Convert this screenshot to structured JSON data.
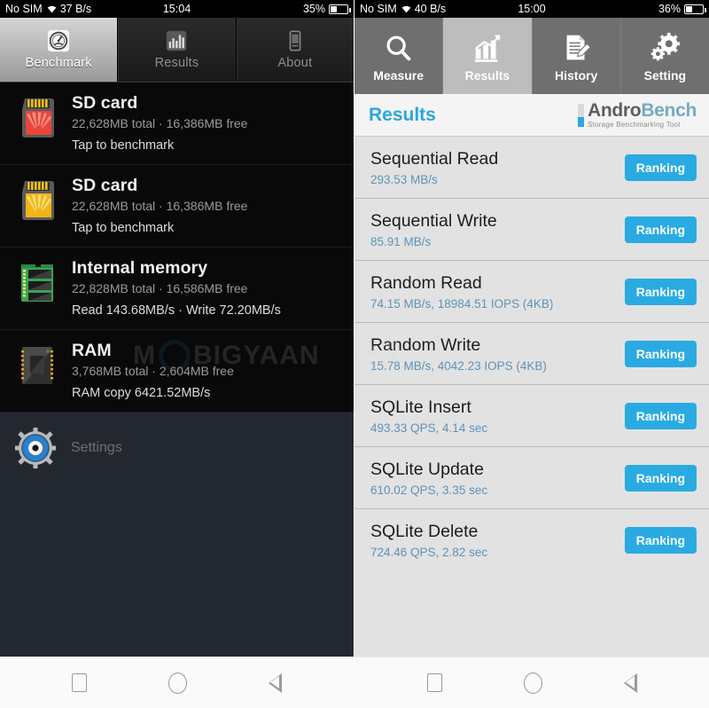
{
  "left_phone": {
    "status_bar": {
      "carrier": "No SIM",
      "wifi_icon": "wifi-icon",
      "network_speed": "37 B/s",
      "clock": "15:04",
      "battery_percent": "35%",
      "battery_icon": "battery-icon"
    },
    "tabs": [
      {
        "label": "Benchmark",
        "icon": "speedometer-icon",
        "active": true
      },
      {
        "label": "Results",
        "icon": "bar-chart-icon",
        "active": false
      },
      {
        "label": "About",
        "icon": "phone-icon",
        "active": false
      }
    ],
    "items": [
      {
        "icon": "sd-card-red-icon",
        "title": "SD card",
        "capacity": "22,628MB total · 16,386MB free",
        "action": "Tap to benchmark"
      },
      {
        "icon": "sd-card-yellow-icon",
        "title": "SD card",
        "capacity": "22,628MB total · 16,386MB free",
        "action": "Tap to benchmark"
      },
      {
        "icon": "memory-module-icon",
        "title": "Internal memory",
        "capacity": "22,828MB total · 16,586MB free",
        "action": "Read 143.68MB/s · Write 72.20MB/s"
      },
      {
        "icon": "ram-chip-icon",
        "title": "RAM",
        "capacity": "3,768MB total · 2,604MB free",
        "action": "RAM copy 6421.52MB/s"
      }
    ],
    "settings": {
      "icon": "gear-eye-icon",
      "label": "Settings"
    },
    "watermark": "MOBIGYAAN",
    "nav_bar": {
      "recents": "recents-square-icon",
      "home": "home-circle-icon",
      "back": "back-triangle-icon"
    }
  },
  "right_phone": {
    "status_bar": {
      "carrier": "No SIM",
      "wifi_icon": "wifi-icon",
      "network_speed": "40 B/s",
      "clock": "15:00",
      "battery_percent": "36%",
      "battery_icon": "battery-icon"
    },
    "tabs": [
      {
        "label": "Measure",
        "icon": "magnifier-icon",
        "active": false
      },
      {
        "label": "Results",
        "icon": "growth-chart-icon",
        "active": true
      },
      {
        "label": "History",
        "icon": "document-pencil-icon",
        "active": false
      },
      {
        "label": "Setting",
        "icon": "gears-icon",
        "active": false
      }
    ],
    "header": {
      "title": "Results",
      "brand_name_part1": "Andro",
      "brand_name_part2": "Bench",
      "brand_tagline": "Storage Benchmarking Tool"
    },
    "ranking_button_label": "Ranking",
    "results": [
      {
        "name": "Sequential Read",
        "value": "293.53 MB/s"
      },
      {
        "name": "Sequential Write",
        "value": "85.91 MB/s"
      },
      {
        "name": "Random Read",
        "value": "74.15 MB/s, 18984.51 IOPS (4KB)"
      },
      {
        "name": "Random Write",
        "value": "15.78 MB/s, 4042.23 IOPS (4KB)"
      },
      {
        "name": "SQLite Insert",
        "value": "493.33 QPS, 4.14 sec"
      },
      {
        "name": "SQLite Update",
        "value": "610.02 QPS, 3.35 sec"
      },
      {
        "name": "SQLite Delete",
        "value": "724.46 QPS, 2.82 sec"
      }
    ],
    "nav_bar": {
      "recents": "recents-square-icon",
      "home": "home-circle-icon",
      "back": "back-triangle-icon"
    }
  },
  "colors": {
    "accent_blue": "#29abe2",
    "value_blue": "#5f93b4",
    "left_bg": "#232830",
    "right_bg": "#e2e2e2"
  }
}
